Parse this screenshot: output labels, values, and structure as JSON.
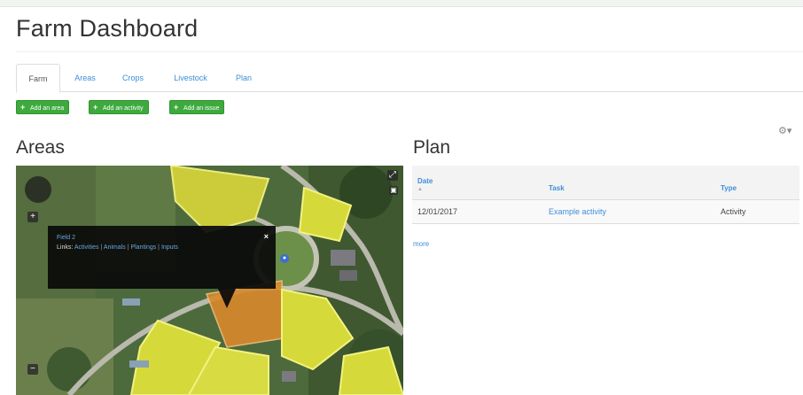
{
  "page": {
    "title": "Farm Dashboard"
  },
  "tabs": [
    {
      "label": "Farm",
      "active": true
    },
    {
      "label": "Areas",
      "active": false
    },
    {
      "label": "Crops",
      "active": false
    },
    {
      "label": "Livestock",
      "active": false
    },
    {
      "label": "Plan",
      "active": false
    }
  ],
  "actions": [
    {
      "label": "Add an area"
    },
    {
      "label": "Add an activity"
    },
    {
      "label": "Add an issue"
    }
  ],
  "areas": {
    "title": "Areas",
    "map": {
      "zoom_in": "+",
      "zoom_out": "−",
      "popup": {
        "title": "Field 2",
        "links_label": "Links:",
        "links": [
          "Activities",
          "Animals",
          "Plantings",
          "Inputs"
        ],
        "close": "×"
      }
    }
  },
  "plan": {
    "title": "Plan",
    "columns": [
      "Date",
      "Task",
      "Type"
    ],
    "sort_indicator": "▲",
    "rows": [
      {
        "date": "12/01/2017",
        "task": "Example activity",
        "type": "Activity"
      }
    ],
    "more": "more"
  },
  "settings": {
    "icon": "gear-icon",
    "glyph": "⚙▾"
  },
  "colors": {
    "accent_link": "#3b8fd9",
    "button_green": "#3eaa3e",
    "field_yellow": "#d6d93a",
    "field_orange": "#d98a2c"
  }
}
